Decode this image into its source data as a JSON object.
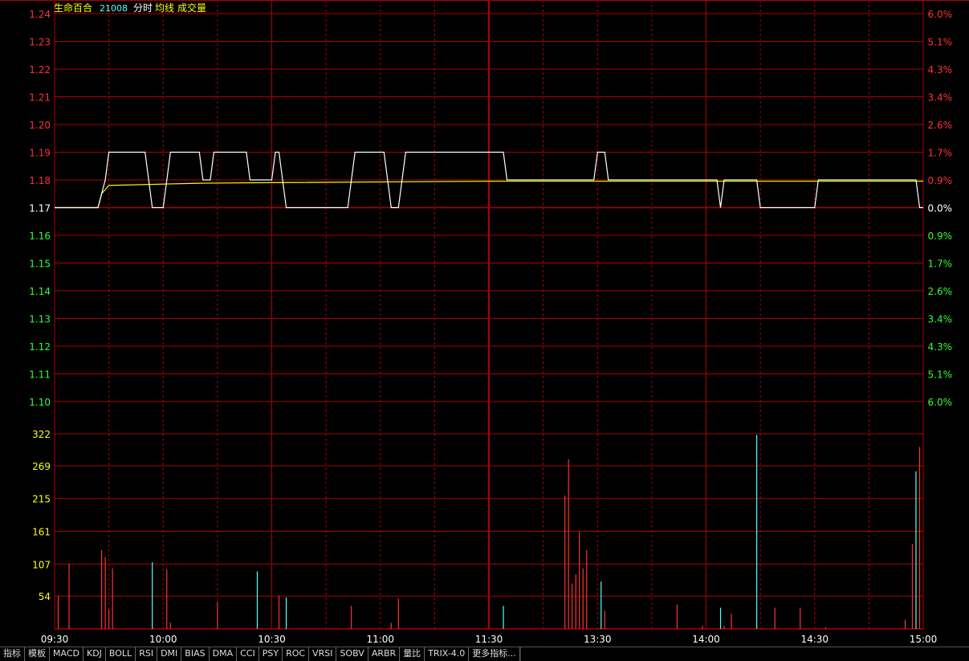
{
  "header": {
    "stock_name": "生命百合",
    "stock_code": "21008",
    "legend_time": "分时",
    "legend_avg": "均线",
    "legend_volume": "成交量"
  },
  "colors": {
    "up": "#ff3232",
    "down": "#32ff32",
    "price_line": "#ffffff",
    "avg_line": "#ffff00",
    "volume_tick": "#ffff00",
    "grid": "#b00000",
    "volume_up_bar": "#ff3232",
    "volume_down_bar": "#54ffff",
    "header_name": "#ffff00",
    "header_code": "#54ffff"
  },
  "chart_data": {
    "type": "line",
    "price_axis": {
      "ticks": [
        "1.24",
        "1.23",
        "1.22",
        "1.21",
        "1.20",
        "1.19",
        "1.18",
        "1.17",
        "1.16",
        "1.15",
        "1.14",
        "1.13",
        "1.12",
        "1.11",
        "1.10"
      ],
      "ylim": [
        1.1,
        1.24
      ],
      "prev_close": 1.17
    },
    "pct_axis": {
      "ticks": [
        "6.0%",
        "5.1%",
        "4.3%",
        "3.4%",
        "2.6%",
        "1.7%",
        "0.9%",
        "0.0%",
        "0.9%",
        "1.7%",
        "2.6%",
        "3.4%",
        "4.3%",
        "5.1%",
        "6.0%"
      ]
    },
    "volume_axis": {
      "ticks": [
        "322",
        "269",
        "215",
        "161",
        "107",
        "54"
      ],
      "ylim": [
        0,
        322
      ]
    },
    "time_axis": {
      "labels": [
        "09:30",
        "10:00",
        "10:30",
        "11:00",
        "11:30",
        "13:30",
        "14:00",
        "14:30",
        "15:00"
      ],
      "total_minutes": 240
    },
    "price_series": [
      [
        0,
        1.17
      ],
      [
        12,
        1.17
      ],
      [
        14,
        1.18
      ],
      [
        15,
        1.19
      ],
      [
        25,
        1.19
      ],
      [
        26,
        1.18
      ],
      [
        27,
        1.17
      ],
      [
        30,
        1.17
      ],
      [
        31,
        1.18
      ],
      [
        32,
        1.19
      ],
      [
        40,
        1.19
      ],
      [
        41,
        1.18
      ],
      [
        43,
        1.18
      ],
      [
        44,
        1.19
      ],
      [
        53,
        1.19
      ],
      [
        54,
        1.18
      ],
      [
        60,
        1.18
      ],
      [
        61,
        1.19
      ],
      [
        62,
        1.19
      ],
      [
        63,
        1.18
      ],
      [
        64,
        1.17
      ],
      [
        81,
        1.17
      ],
      [
        82,
        1.18
      ],
      [
        83,
        1.19
      ],
      [
        91,
        1.19
      ],
      [
        92,
        1.18
      ],
      [
        93,
        1.17
      ],
      [
        95,
        1.17
      ],
      [
        96,
        1.18
      ],
      [
        97,
        1.19
      ],
      [
        124,
        1.19
      ],
      [
        125,
        1.18
      ],
      [
        149,
        1.18
      ],
      [
        150,
        1.19
      ],
      [
        152,
        1.19
      ],
      [
        153,
        1.18
      ],
      [
        183,
        1.18
      ],
      [
        184,
        1.17
      ],
      [
        185,
        1.18
      ],
      [
        194,
        1.18
      ],
      [
        195,
        1.17
      ],
      [
        210,
        1.17
      ],
      [
        211,
        1.18
      ],
      [
        238,
        1.18
      ],
      [
        239,
        1.17
      ],
      [
        240,
        1.17
      ]
    ],
    "avg_series": [
      [
        0,
        1.17
      ],
      [
        12,
        1.17
      ],
      [
        13,
        1.175
      ],
      [
        15,
        1.178
      ],
      [
        30,
        1.1785
      ],
      [
        40,
        1.1788
      ],
      [
        60,
        1.179
      ],
      [
        120,
        1.1795
      ],
      [
        240,
        1.1795
      ]
    ],
    "volume_bars": [
      [
        1,
        54,
        "up"
      ],
      [
        4,
        107,
        "up"
      ],
      [
        13,
        130,
        "up"
      ],
      [
        14,
        118,
        "up"
      ],
      [
        15,
        32,
        "up"
      ],
      [
        16,
        100,
        "up"
      ],
      [
        27,
        110,
        "down"
      ],
      [
        31,
        98,
        "up"
      ],
      [
        32,
        10,
        "up"
      ],
      [
        45,
        45,
        "up"
      ],
      [
        56,
        95,
        "down"
      ],
      [
        62,
        55,
        "up"
      ],
      [
        64,
        52,
        "down"
      ],
      [
        82,
        38,
        "up"
      ],
      [
        93,
        10,
        "up"
      ],
      [
        95,
        50,
        "up"
      ],
      [
        124,
        38,
        "down"
      ],
      [
        141,
        220,
        "up"
      ],
      [
        142,
        280,
        "up"
      ],
      [
        143,
        75,
        "up"
      ],
      [
        144,
        90,
        "up"
      ],
      [
        145,
        160,
        "up"
      ],
      [
        146,
        100,
        "up"
      ],
      [
        147,
        130,
        "up"
      ],
      [
        151,
        78,
        "down"
      ],
      [
        152,
        30,
        "up"
      ],
      [
        172,
        40,
        "up"
      ],
      [
        179,
        5,
        "up"
      ],
      [
        184,
        35,
        "down"
      ],
      [
        185,
        5,
        "up"
      ],
      [
        187,
        25,
        "up"
      ],
      [
        194,
        320,
        "down"
      ],
      [
        199,
        35,
        "up"
      ],
      [
        206,
        35,
        "up"
      ],
      [
        213,
        3,
        "up"
      ],
      [
        235,
        15,
        "up"
      ],
      [
        237,
        140,
        "up"
      ],
      [
        238,
        260,
        "down"
      ],
      [
        239,
        300,
        "up"
      ]
    ]
  },
  "toolbar": {
    "tabs": [
      "指标",
      "模板",
      "MACD",
      "KDJ",
      "BOLL",
      "RSI",
      "DMI",
      "BIAS",
      "DMA",
      "CCI",
      "PSY",
      "ROC",
      "VRSI",
      "SOBV",
      "ARBR",
      "量比",
      "TRIX-4.0",
      "更多指标..."
    ]
  }
}
